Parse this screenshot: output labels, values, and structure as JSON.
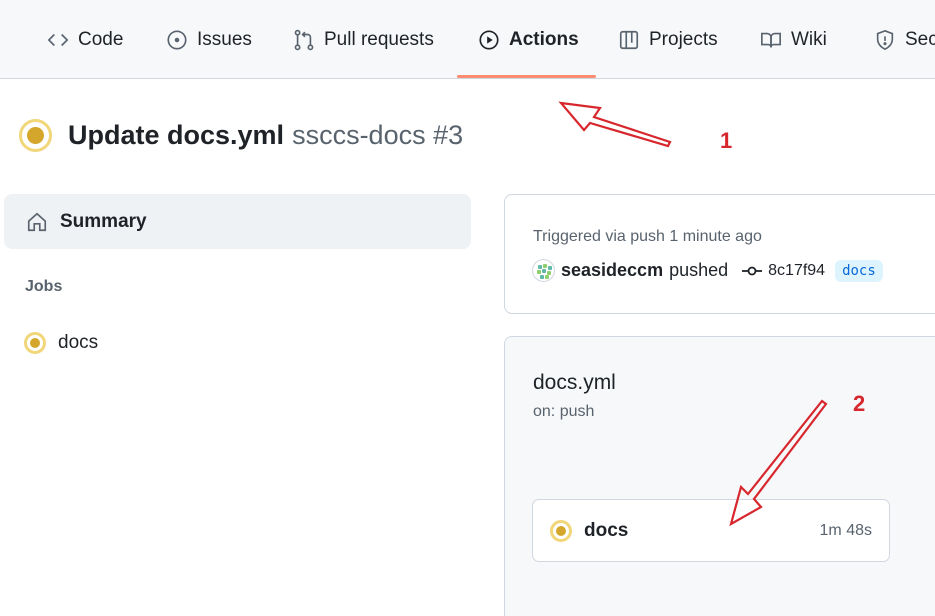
{
  "nav": {
    "tabs": [
      {
        "label": "Code",
        "icon": "code-icon"
      },
      {
        "label": "Issues",
        "icon": "issue-opened-icon"
      },
      {
        "label": "Pull requests",
        "icon": "git-pull-request-icon"
      },
      {
        "label": "Actions",
        "icon": "play-icon",
        "selected": true
      },
      {
        "label": "Projects",
        "icon": "table-icon"
      },
      {
        "label": "Wiki",
        "icon": "book-icon"
      },
      {
        "label": "Sec",
        "icon": "shield-icon"
      }
    ]
  },
  "run": {
    "title": "Update docs.yml",
    "subtitle": "ssccs-docs #3",
    "status": "in_progress",
    "status_color": "#d4a72c"
  },
  "sidebar": {
    "summary_label": "Summary",
    "jobs_heading": "Jobs",
    "jobs": [
      {
        "label": "docs"
      }
    ]
  },
  "trigger": {
    "text": "Triggered via push 1 minute ago",
    "actor": "seasideccm",
    "action": "pushed",
    "sha": "8c17f94",
    "branch": "docs"
  },
  "workflow": {
    "file": "docs.yml",
    "on": "on: push",
    "job_name": "docs",
    "job_duration": "1m 48s"
  },
  "annotations": {
    "marker_1": "1",
    "marker_2": "2",
    "color": "#d7272d"
  }
}
